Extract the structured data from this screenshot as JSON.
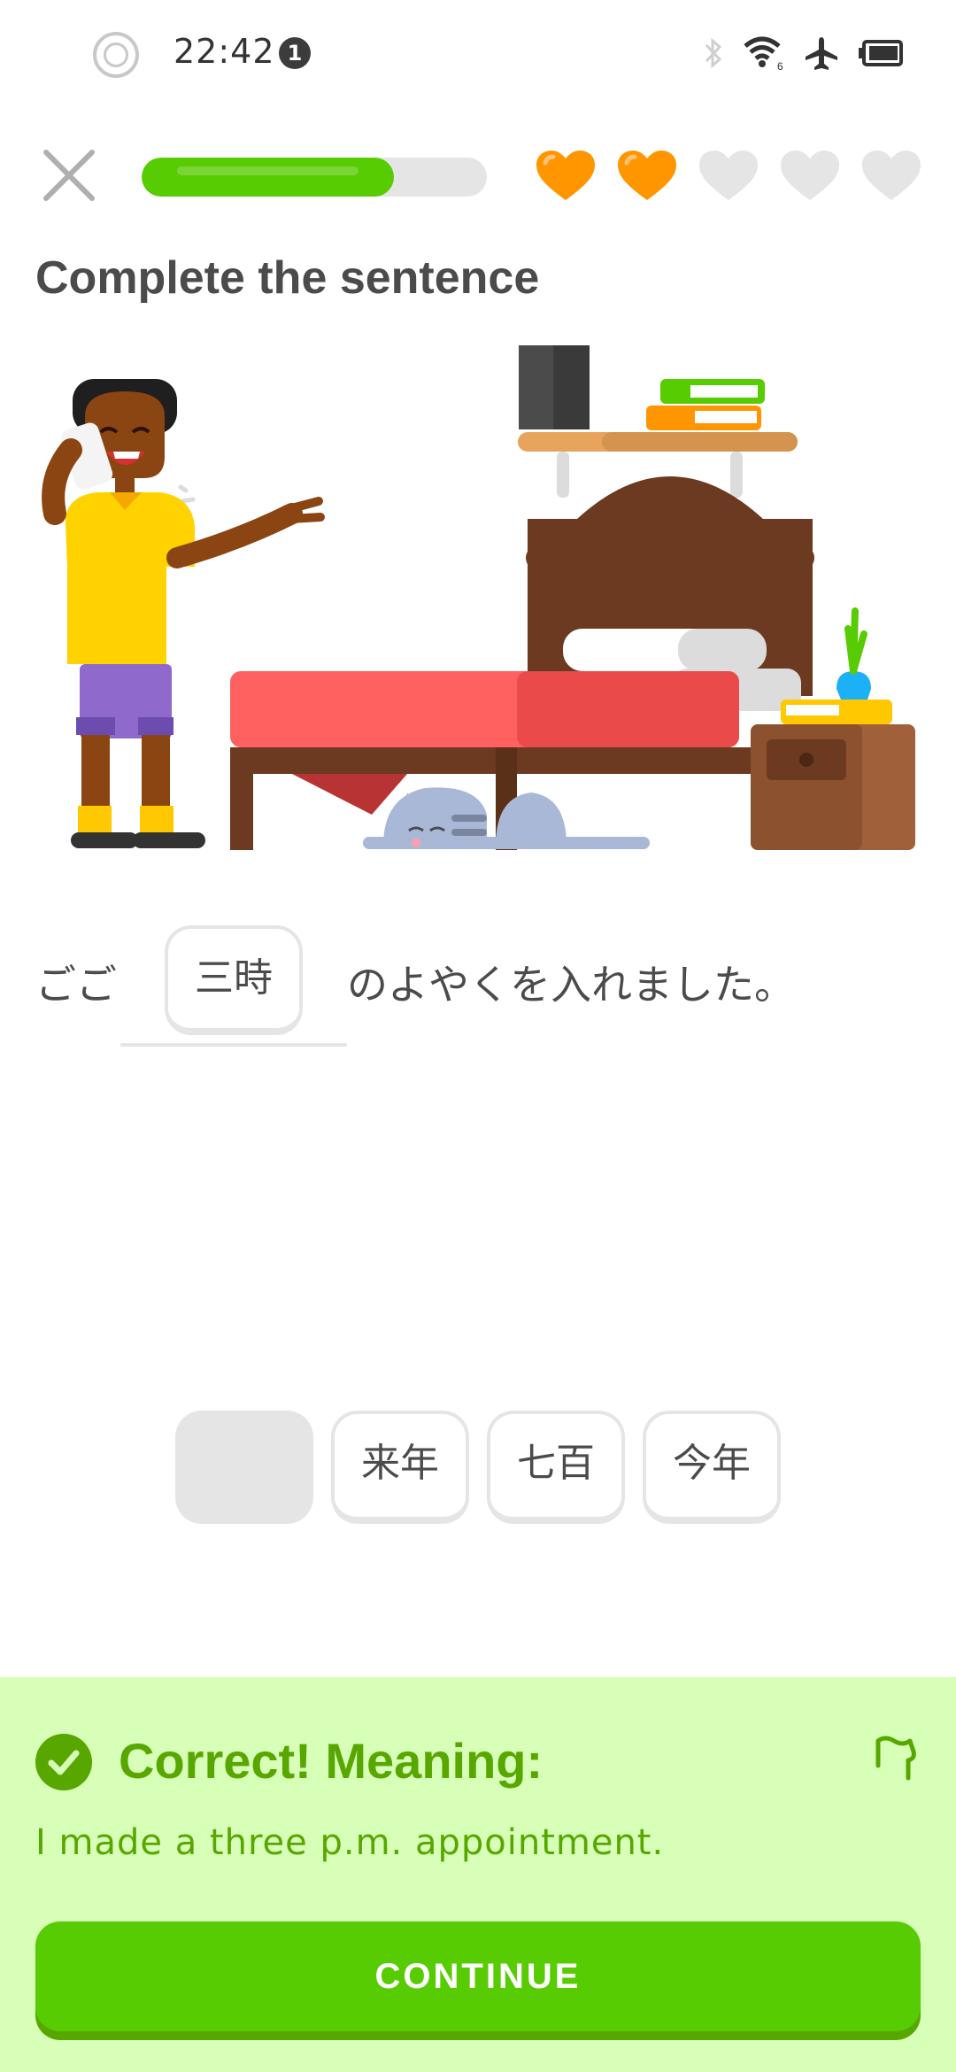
{
  "status_bar": {
    "time": "22:42",
    "notification_count": "1",
    "icons": [
      "circle-status-icon",
      "bluetooth-icon",
      "wifi-icon",
      "airplane-mode-icon",
      "battery-icon"
    ]
  },
  "lesson": {
    "progress": 0.73,
    "hearts": {
      "filled": 2,
      "total": 5
    },
    "colors": {
      "progress": "#58cc02",
      "heart_full": "#ff9600",
      "heart_empty": "#e5e5e5"
    }
  },
  "prompt": {
    "title": "Complete the sentence"
  },
  "sentence": {
    "before": "ごご",
    "answer": "三時",
    "after": "のよやくを入れました。"
  },
  "word_bank": [
    "",
    "来年",
    "七百",
    "今年"
  ],
  "feedback": {
    "title": "Correct! Meaning:",
    "meaning": "I made a three p.m. appointment.",
    "continue_label": "CONTINUE",
    "colors": {
      "background": "#d7ffb8",
      "accent": "#58a700",
      "button": "#58cc02"
    }
  }
}
